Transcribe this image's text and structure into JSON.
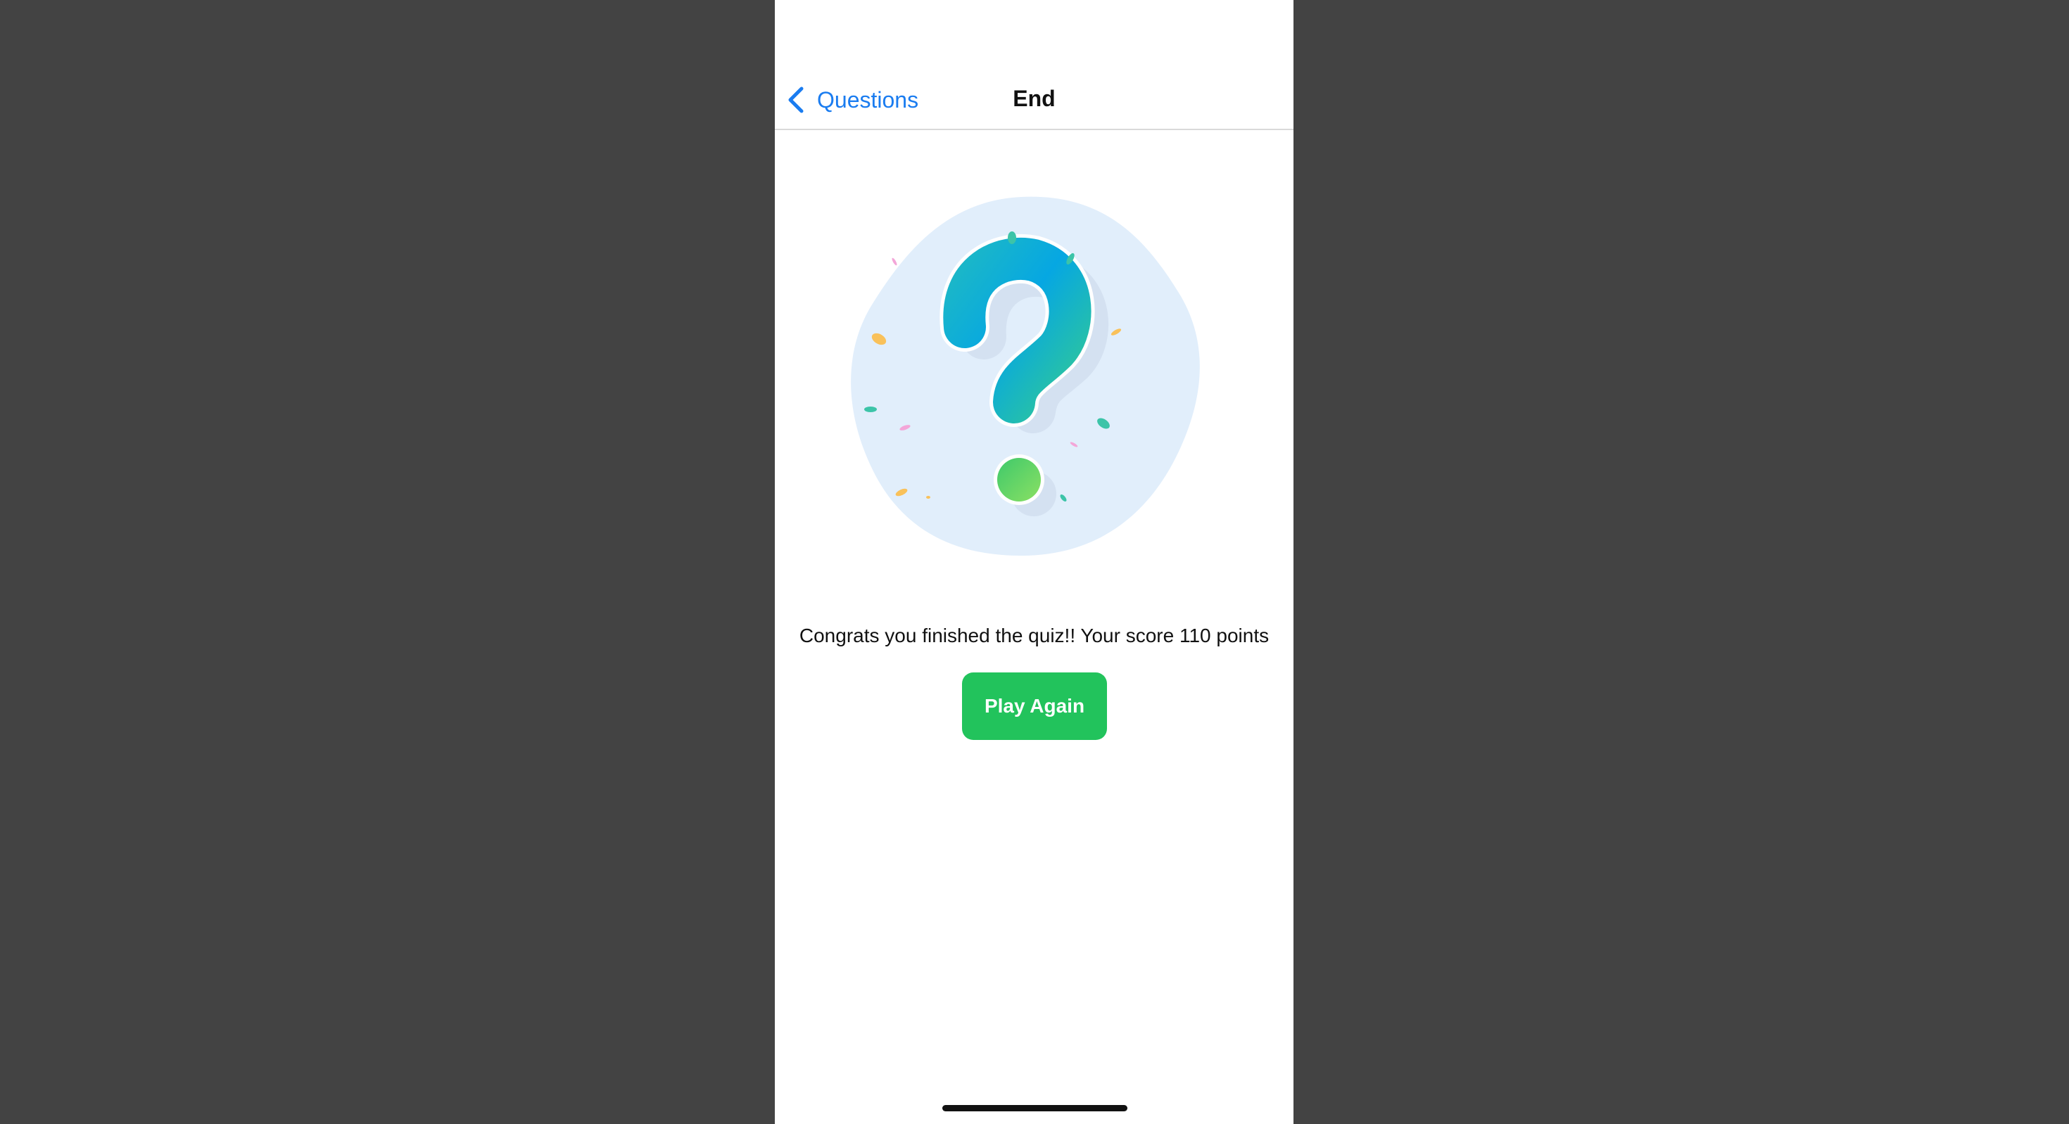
{
  "navbar": {
    "back_label": "Questions",
    "title": "End"
  },
  "main": {
    "message": "Congrats you finished the quiz!! Your score 110 points",
    "play_again_label": "Play Again"
  },
  "illustration": {
    "icon": "question-mark-icon"
  },
  "colors": {
    "accent": "#1a7cf0",
    "button": "#22c35c",
    "device_background": "#434343"
  }
}
